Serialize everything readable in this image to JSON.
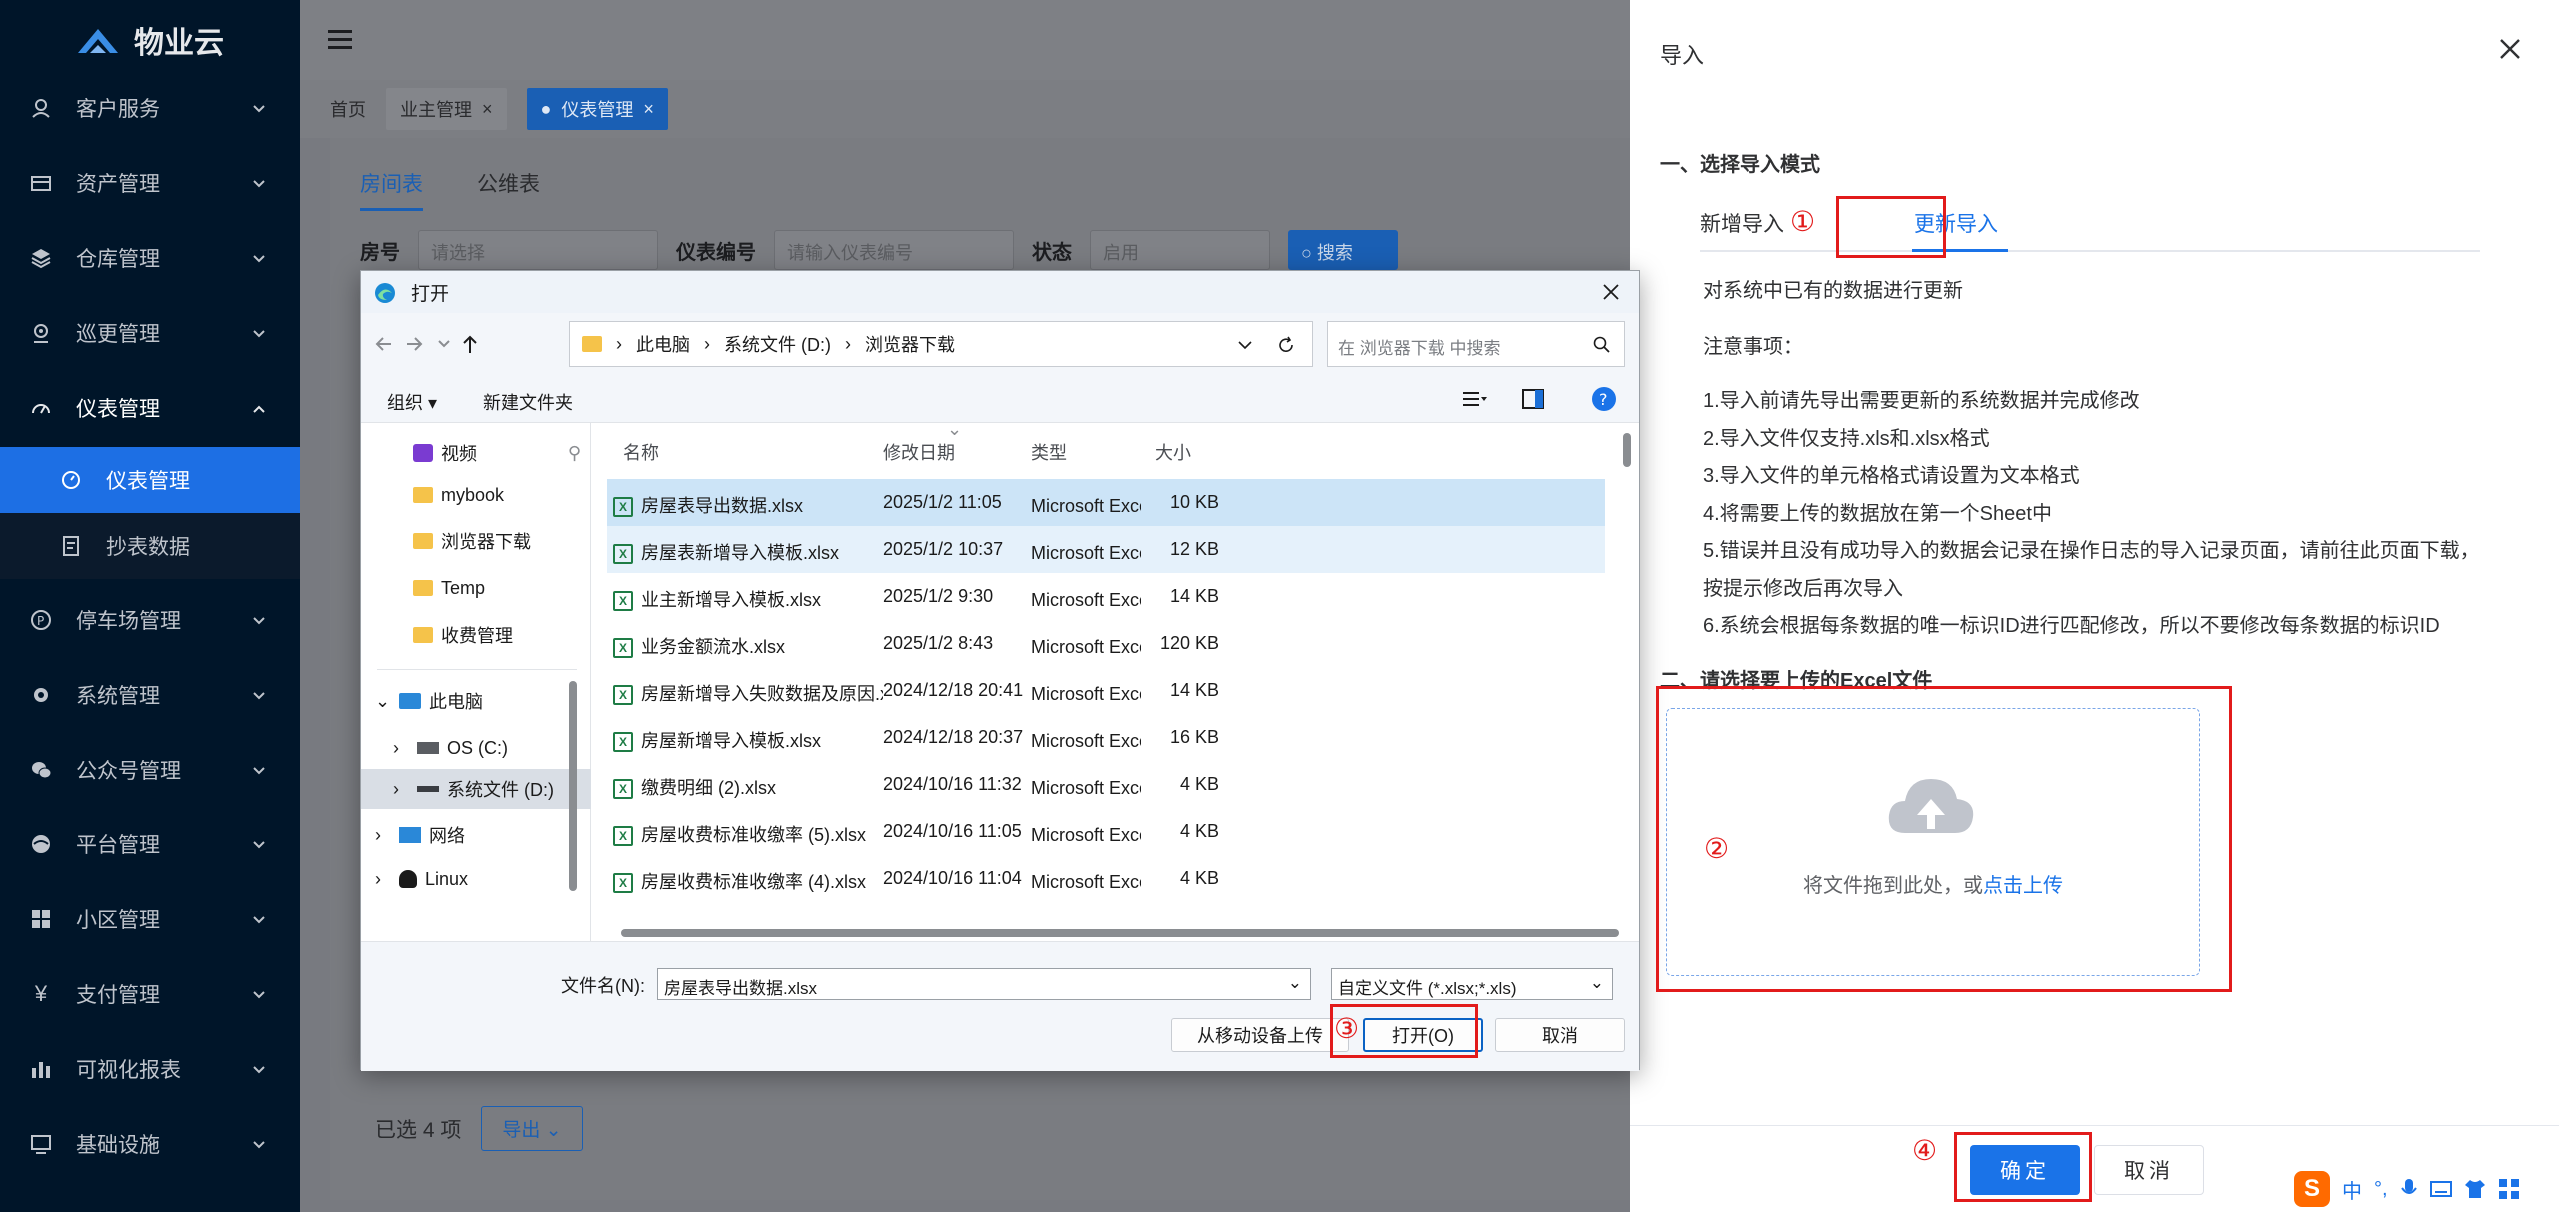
{
  "app": {
    "name": "物业云"
  },
  "sidebar": {
    "items": [
      {
        "label": "客户服务",
        "icon": "customer-service-icon"
      },
      {
        "label": "资产管理",
        "icon": "assets-icon"
      },
      {
        "label": "仓库管理",
        "icon": "warehouse-icon"
      },
      {
        "label": "巡更管理",
        "icon": "patrol-icon"
      },
      {
        "label": "仪表管理",
        "icon": "meter-icon"
      },
      {
        "label": "仪表管理",
        "icon": "gauge-icon"
      },
      {
        "label": "抄表数据",
        "icon": "reading-data-icon"
      },
      {
        "label": "停车场管理",
        "icon": "parking-icon"
      },
      {
        "label": "系统管理",
        "icon": "system-gear-icon"
      },
      {
        "label": "公众号管理",
        "icon": "wechat-icon"
      },
      {
        "label": "平台管理",
        "icon": "platform-icon"
      },
      {
        "label": "小区管理",
        "icon": "community-icon"
      },
      {
        "label": "支付管理",
        "icon": "yen-icon"
      },
      {
        "label": "可视化报表",
        "icon": "bar-chart-icon"
      },
      {
        "label": "基础设施",
        "icon": "infrastructure-icon"
      }
    ]
  },
  "breadcrumb_tabs": [
    {
      "label": "首页"
    },
    {
      "label": "业主管理",
      "close": "×"
    },
    {
      "label": "仪表管理",
      "close": "×"
    }
  ],
  "subtabs": [
    "房间表",
    "公维表"
  ],
  "filters": {
    "room_label": "房号",
    "room_placeholder": "请选择",
    "meter_label": "仪表编号",
    "meter_placeholder": "请输入仪表编号",
    "status_label": "状态",
    "status_value": "启用",
    "search_button": "搜索"
  },
  "footer": {
    "selected": "已选 4 项",
    "export": "导出"
  },
  "drawer": {
    "title": "导入",
    "section1": "一、选择导入模式",
    "tabs": [
      "新增导入",
      "更新导入"
    ],
    "description": "对系统中已有的数据进行更新",
    "notes_title": "注意事项：",
    "notes": [
      "1.导入前请先导出需要更新的系统数据并完成修改",
      "2.导入文件仅支持.xls和.xlsx格式",
      "3.导入文件的单元格格式请设置为文本格式",
      "4.将需要上传的数据放在第一个Sheet中",
      "5.错误并且没有成功导入的数据会记录在操作日志的导入记录页面，请前往此页面下载，按提示修改后再次导入",
      "6.系统会根据每条数据的唯一标识ID进行匹配修改，所以不要修改每条数据的标识ID"
    ],
    "section2": "二、请选择要上传的Excel文件",
    "upload_text": "将文件拖到此处，或",
    "upload_link": "点击上传",
    "ok": "确定",
    "cancel": "取消"
  },
  "annotations": [
    "①",
    "②",
    "③",
    "④"
  ],
  "dialog": {
    "title": "打开",
    "path": [
      "此电脑",
      "系统文件 (D:)",
      "浏览器下载"
    ],
    "search_placeholder": "在 浏览器下载 中搜索",
    "organize": "组织 ▾",
    "new_folder": "新建文件夹",
    "nav": [
      {
        "label": "视频",
        "kind": "video"
      },
      {
        "label": "mybook",
        "kind": "folder"
      },
      {
        "label": "浏览器下载",
        "kind": "folder"
      },
      {
        "label": "Temp",
        "kind": "folder"
      },
      {
        "label": "收费管理",
        "kind": "folder"
      },
      {
        "label": "此电脑",
        "kind": "pc"
      },
      {
        "label": "OS (C:)",
        "kind": "drive"
      },
      {
        "label": "系统文件 (D:)",
        "kind": "drive"
      },
      {
        "label": "网络",
        "kind": "network"
      },
      {
        "label": "Linux",
        "kind": "linux"
      }
    ],
    "columns": [
      "名称",
      "修改日期",
      "类型",
      "大小"
    ],
    "files": [
      {
        "name": "房屋表导出数据.xlsx",
        "date": "2025/1/2 11:05",
        "type": "Microsoft Excel 工...",
        "size": "10 KB"
      },
      {
        "name": "房屋表新增导入模板.xlsx",
        "date": "2025/1/2 10:37",
        "type": "Microsoft Excel 工...",
        "size": "12 KB"
      },
      {
        "name": "业主新增导入模板.xlsx",
        "date": "2025/1/2 9:30",
        "type": "Microsoft Excel 工...",
        "size": "14 KB"
      },
      {
        "name": "业务金额流水.xlsx",
        "date": "2025/1/2 8:43",
        "type": "Microsoft Excel 工...",
        "size": "120 KB"
      },
      {
        "name": "房屋新增导入失败数据及原因.xlsx",
        "date": "2024/12/18 20:41",
        "type": "Microsoft Excel 工...",
        "size": "14 KB"
      },
      {
        "name": "房屋新增导入模板.xlsx",
        "date": "2024/12/18 20:37",
        "type": "Microsoft Excel 工...",
        "size": "16 KB"
      },
      {
        "name": "缴费明细 (2).xlsx",
        "date": "2024/10/16 11:32",
        "type": "Microsoft Excel 工...",
        "size": "4 KB"
      },
      {
        "name": "房屋收费标准收缴率 (5).xlsx",
        "date": "2024/10/16 11:05",
        "type": "Microsoft Excel 工...",
        "size": "4 KB"
      },
      {
        "name": "房屋收费标准收缴率 (4).xlsx",
        "date": "2024/10/16 11:04",
        "type": "Microsoft Excel 工...",
        "size": "4 KB"
      }
    ],
    "filename_label": "文件名(N):",
    "filename_value": "房屋表导出数据.xlsx",
    "filetype_value": "自定义文件 (*.xlsx;*.xls)",
    "mobile_upload": "从移动设备上传",
    "open": "打开(O)",
    "cancel": "取消"
  },
  "ime": {
    "labels": [
      "中",
      "°,"
    ]
  }
}
